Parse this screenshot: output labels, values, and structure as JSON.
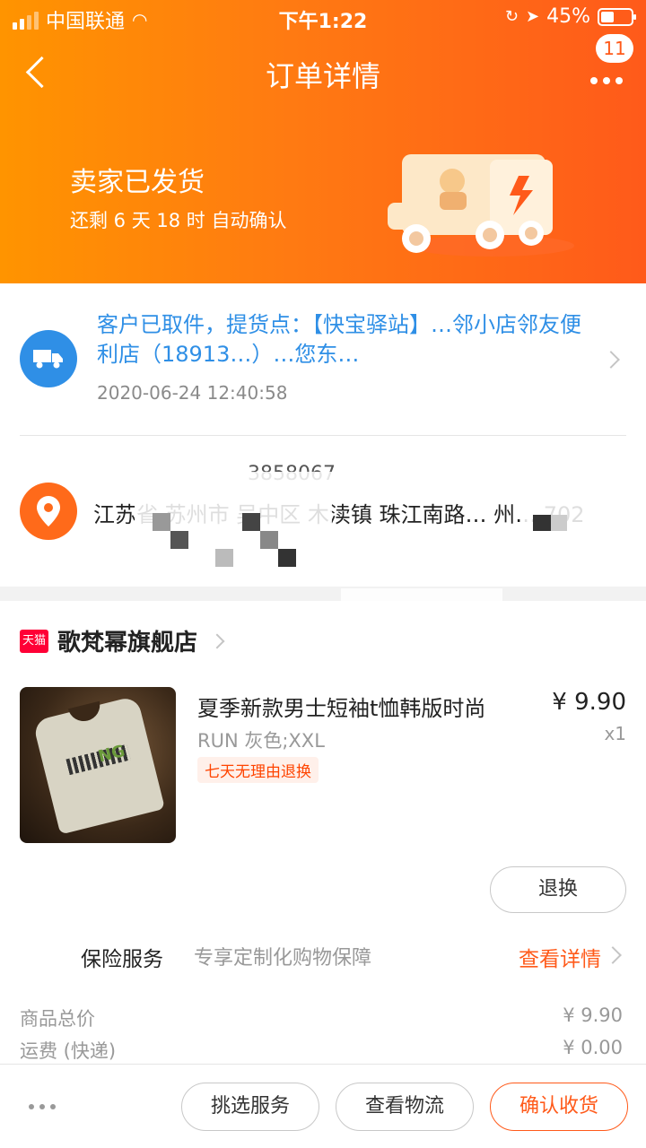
{
  "status_bar": {
    "carrier": "中国联通",
    "time": "下午1:22",
    "battery": "45%"
  },
  "nav": {
    "title": "订单详情",
    "badge_count": "11"
  },
  "shipping": {
    "title": "卖家已发货",
    "subtitle": "还剩 6 天 18 时 自动确认"
  },
  "logistics": {
    "text": "客户已取件，提货点：【快宝驿站】…邻小店邻友便利店（18913…）…您东…",
    "time": "2020-06-24 12:40:58"
  },
  "address": {
    "phone": "3858067",
    "text": "江苏省 苏州市 吴中区 木渎镇 珠江南路… 州… 702"
  },
  "shop": {
    "badge": "天猫",
    "name": "歌梵幂旗舰店"
  },
  "product": {
    "title": "夏季新款男士短袖t恤韩版时尚",
    "sku": "RUN 灰色;XXL",
    "tag": "七天无理由退换",
    "price": "¥ 9.90",
    "qty": "x1",
    "refund_label": "退换"
  },
  "insurance": {
    "label": "保险服务",
    "desc": "专享定制化购物保障",
    "link": "查看详情"
  },
  "prices": {
    "total_label": "商品总价",
    "total_value": "¥ 9.90",
    "shipping_label": "运费 (快递)",
    "shipping_value": "¥ 0.00"
  },
  "bottom_bar": {
    "service_label": "挑选服务",
    "logistics_label": "查看物流",
    "confirm_label": "确认收货"
  },
  "colors": {
    "brand_orange": "#ff5a1a",
    "link_blue": "#2f8fe6"
  }
}
